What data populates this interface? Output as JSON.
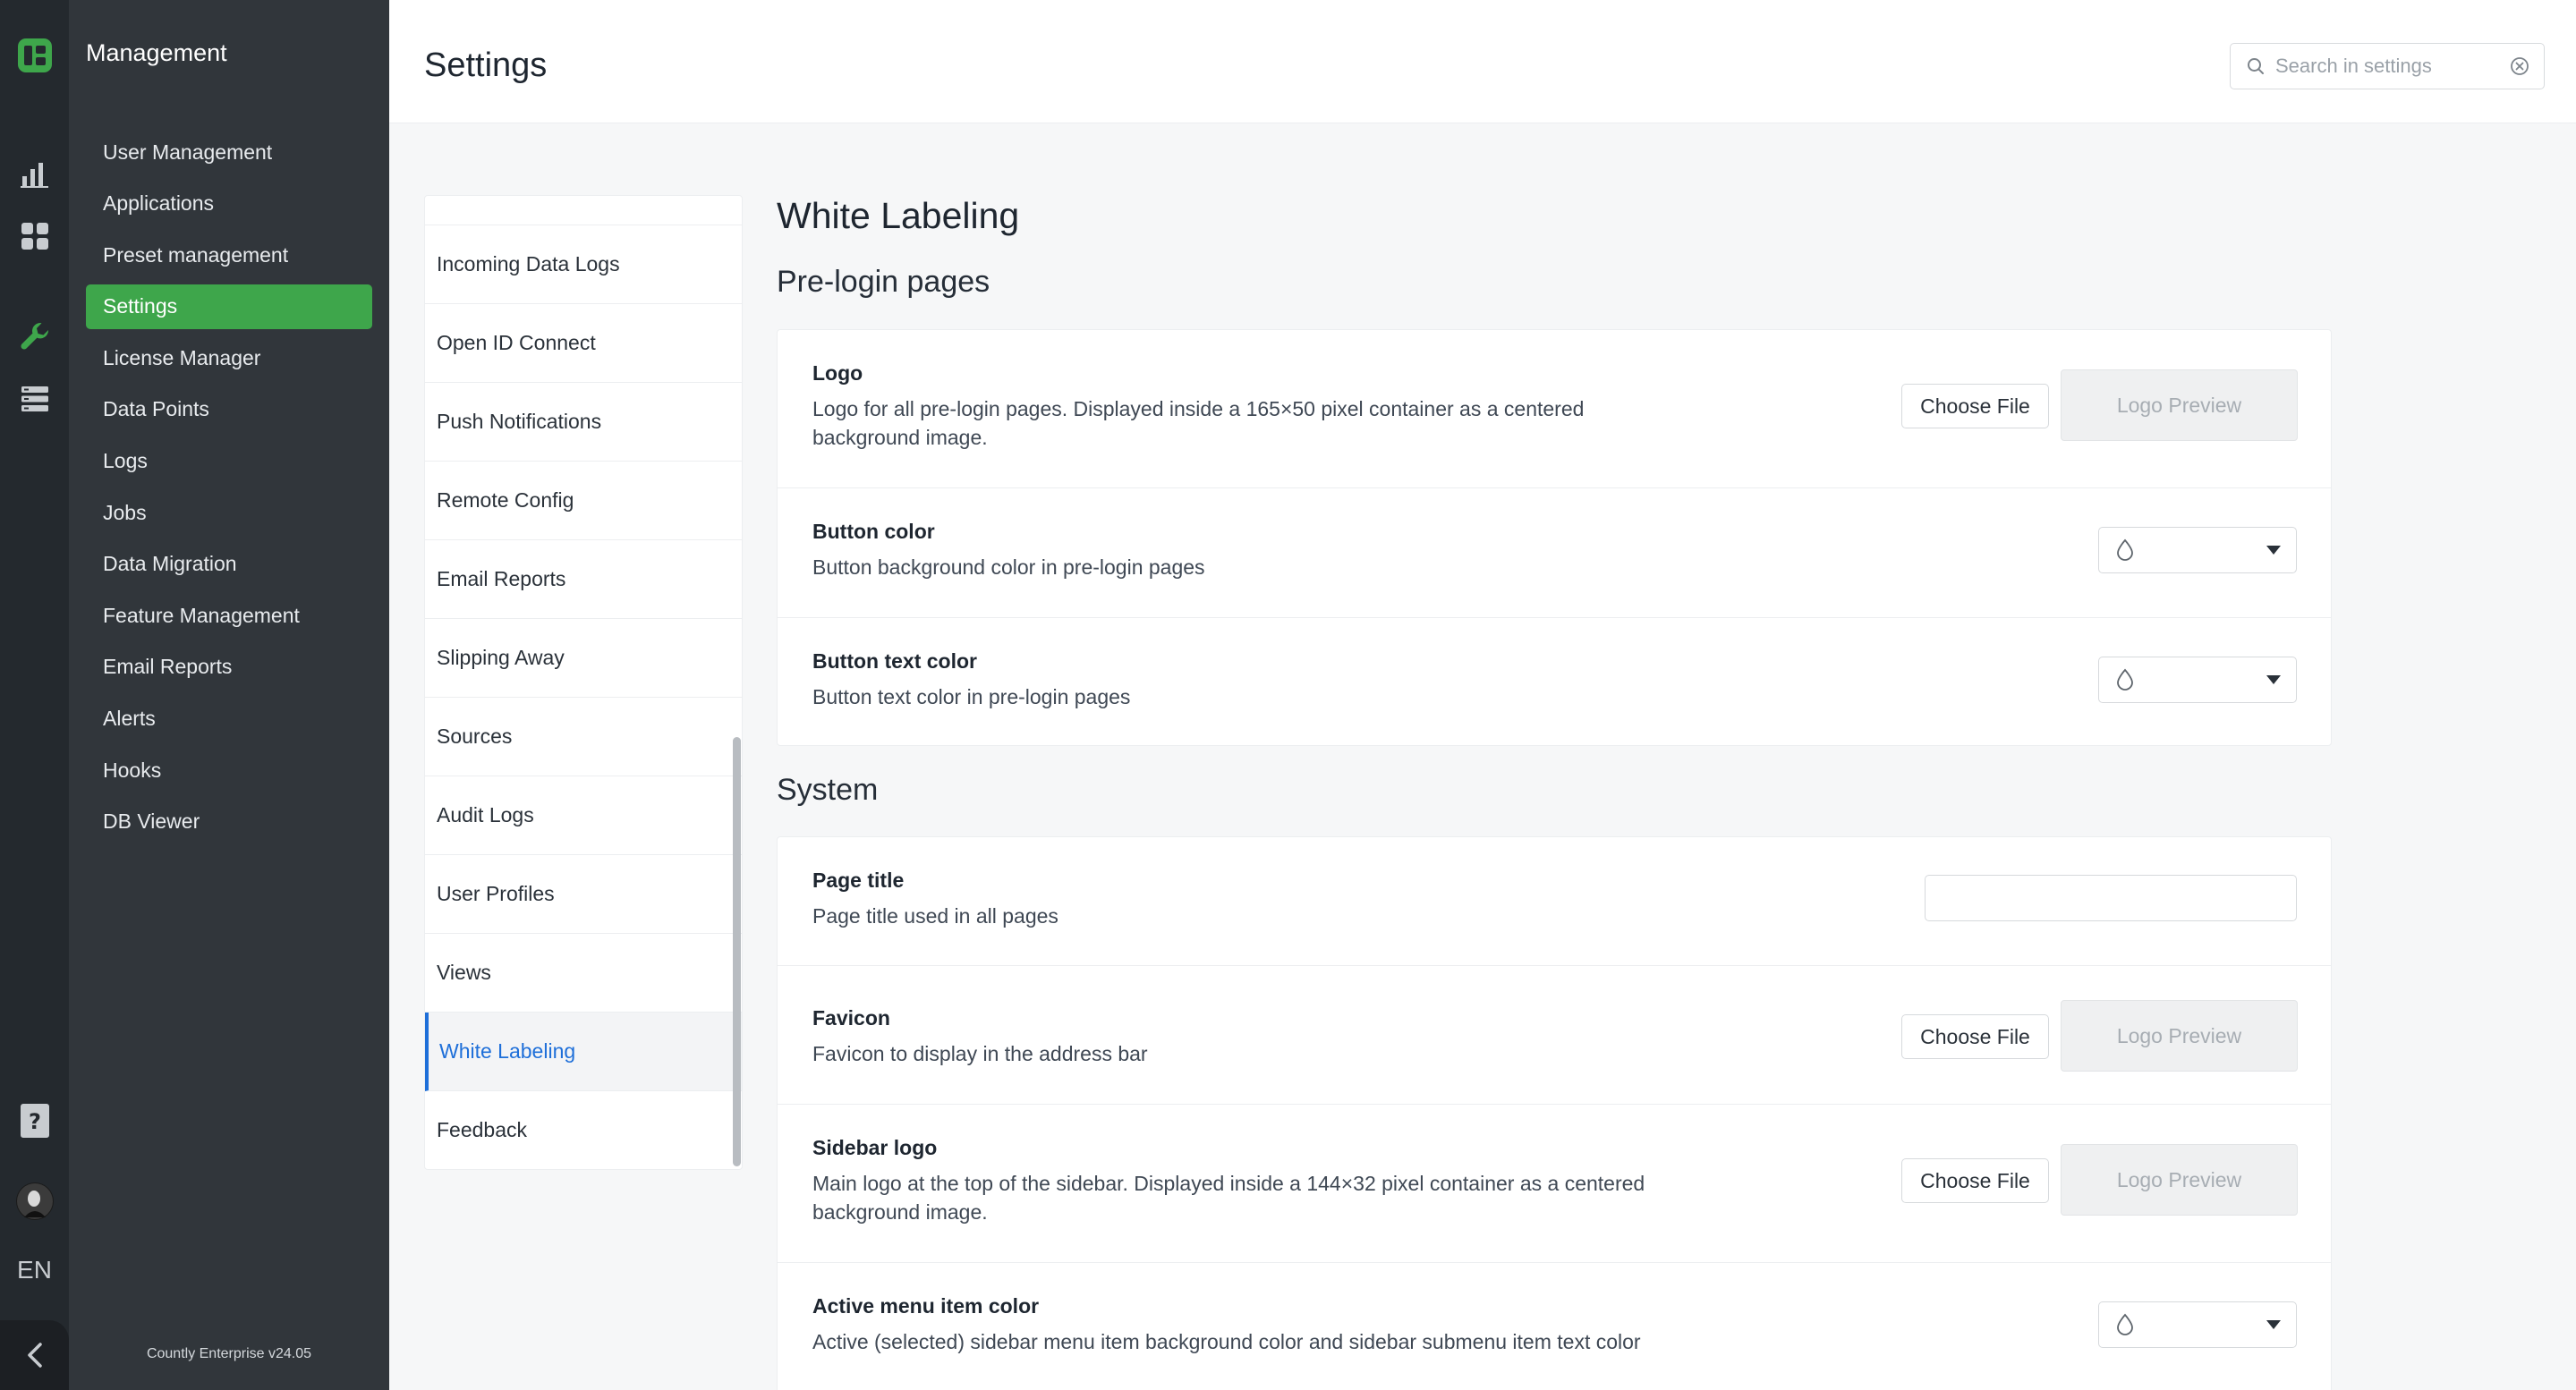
{
  "brand": {
    "accent": "#3ea64b",
    "link": "#1e6fd9",
    "icon_name": "countly-logo-icon"
  },
  "rail": {
    "items": [
      "analytics-icon",
      "dashboards-icon",
      "management-icon",
      "data-manager-icon",
      "help-icon",
      "avatar"
    ],
    "language": "EN"
  },
  "sidebar": {
    "title": "Management",
    "items": [
      {
        "label": "User Management"
      },
      {
        "label": "Applications"
      },
      {
        "label": "Preset management"
      },
      {
        "label": "Settings",
        "active": true
      },
      {
        "label": "License Manager"
      },
      {
        "label": "Data Points"
      },
      {
        "label": "Logs"
      },
      {
        "label": "Jobs"
      },
      {
        "label": "Data Migration"
      },
      {
        "label": "Feature Management"
      },
      {
        "label": "Email Reports"
      },
      {
        "label": "Alerts"
      },
      {
        "label": "Hooks"
      },
      {
        "label": "DB Viewer"
      }
    ],
    "version": "Countly Enterprise v24.05"
  },
  "header": {
    "title": "Settings",
    "search_placeholder": "Search in settings"
  },
  "settings_nav": {
    "items": [
      {
        "label": "Incoming Data Logs"
      },
      {
        "label": "Open ID Connect"
      },
      {
        "label": "Push Notifications"
      },
      {
        "label": "Remote Config"
      },
      {
        "label": "Email Reports"
      },
      {
        "label": "Slipping Away"
      },
      {
        "label": "Sources"
      },
      {
        "label": "Audit Logs"
      },
      {
        "label": "User Profiles"
      },
      {
        "label": "Views"
      },
      {
        "label": "White Labeling",
        "active": true
      },
      {
        "label": "Feedback"
      }
    ]
  },
  "main": {
    "section_title": "White Labeling",
    "choose_file_label": "Choose File",
    "preview_label": "Logo Preview",
    "groups": [
      {
        "title": "Pre-login pages",
        "rows": [
          {
            "label": "Logo",
            "desc": "Logo for all pre-login pages. Displayed inside a 165×50 pixel container as a centered background image.",
            "control": "file"
          },
          {
            "label": "Button color",
            "desc": "Button background color in pre-login pages",
            "control": "color"
          },
          {
            "label": "Button text color",
            "desc": "Button text color in pre-login pages",
            "control": "color"
          }
        ]
      },
      {
        "title": "System",
        "rows": [
          {
            "label": "Page title",
            "desc": "Page title used in all pages",
            "control": "text",
            "value": ""
          },
          {
            "label": "Favicon",
            "desc": "Favicon to display in the address bar",
            "control": "file"
          },
          {
            "label": "Sidebar logo",
            "desc": "Main logo at the top of the sidebar. Displayed inside a 144×32 pixel container as a centered background image.",
            "control": "file"
          },
          {
            "label": "Active menu item color",
            "desc": "Active (selected) sidebar menu item background color and sidebar submenu item text color",
            "control": "color"
          }
        ]
      }
    ]
  }
}
